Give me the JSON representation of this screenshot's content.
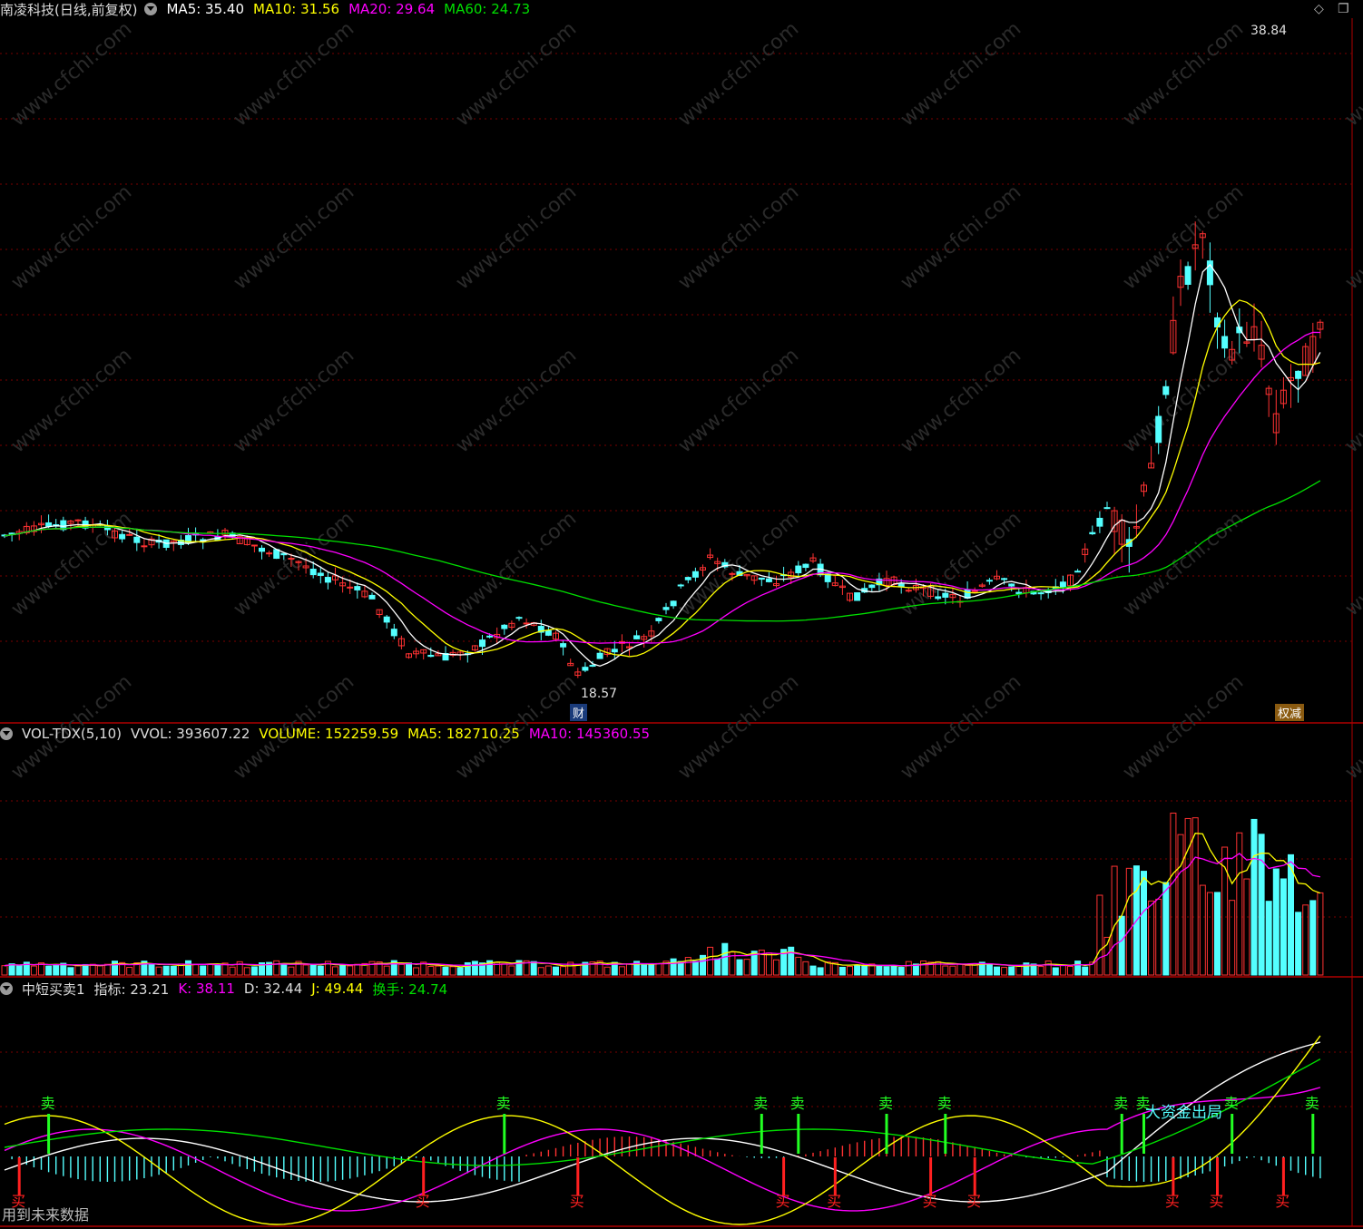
{
  "main_panel": {
    "stock_name": "南凌科技(日线,前复权)",
    "ma": [
      {
        "label": "MA5: 35.40",
        "color": "#ffffff"
      },
      {
        "label": "MA10: 31.56",
        "color": "#ffff00"
      },
      {
        "label": "MA20: 29.64",
        "color": "#ff00ff"
      },
      {
        "label": "MA60: 24.73",
        "color": "#00e000"
      }
    ],
    "high_label": "38.84",
    "low_label": "18.57",
    "fin_tag": "财",
    "reduce_tag": "权减"
  },
  "vol_panel": {
    "items": [
      {
        "label": "VOL-TDX(5,10)",
        "color": "#dddddd"
      },
      {
        "label": "VVOL: 393607.22",
        "color": "#dddddd"
      },
      {
        "label": "VOLUME: 152259.59",
        "color": "#ffff00"
      },
      {
        "label": "MA5: 182710.25",
        "color": "#ffff00"
      },
      {
        "label": "MA10: 145360.55",
        "color": "#ff00ff"
      }
    ]
  },
  "ind_panel": {
    "items": [
      {
        "label": "中短买卖1",
        "color": "#dddddd"
      },
      {
        "label": "指标: 23.21",
        "color": "#dddddd"
      },
      {
        "label": "K: 38.11",
        "color": "#ff00ff"
      },
      {
        "label": "D: 32.44",
        "color": "#dddddd"
      },
      {
        "label": "J: 49.44",
        "color": "#ffff00"
      },
      {
        "label": "换手: 24.74",
        "color": "#00e000"
      }
    ],
    "buy_label": "买",
    "sell_label": "卖",
    "big_text": "大资金出局",
    "future_note": "用到未来数据"
  },
  "watermark": "www.cfchi.com",
  "colors": {
    "up": "#ff3232",
    "down": "#54ffff",
    "ma5": "#ffffff",
    "ma10": "#ffff00",
    "ma20": "#ff00ff",
    "ma60": "#00e000",
    "grid": "#7a0000",
    "border": "#b00000"
  }
}
